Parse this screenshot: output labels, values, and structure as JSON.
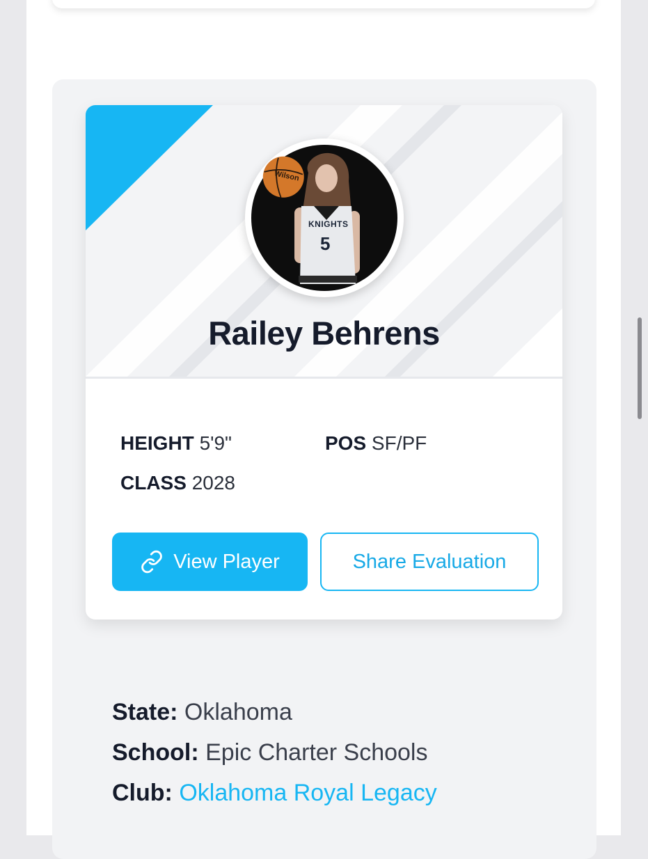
{
  "player": {
    "name": "Railey Behrens",
    "jersey_number": "5",
    "jersey_text": "KNIGHTS",
    "ball_brand": "Wilson",
    "stats": {
      "height_label": "HEIGHT",
      "height_value": "5'9\"",
      "pos_label": "POS",
      "pos_value": "SF/PF",
      "class_label": "CLASS",
      "class_value": "2028"
    }
  },
  "actions": {
    "view_player": "View Player",
    "share_evaluation": "Share Evaluation"
  },
  "info": {
    "state_label": "State:",
    "state_value": "Oklahoma",
    "school_label": "School:",
    "school_value": "Epic Charter Schools",
    "club_label": "Club:",
    "club_value": "Oklahoma Royal Legacy"
  },
  "colors": {
    "accent": "#17b6f3",
    "text_dark": "#151b2b",
    "section_bg": "#f2f3f5"
  },
  "icons": {
    "view_player": "link-icon"
  }
}
